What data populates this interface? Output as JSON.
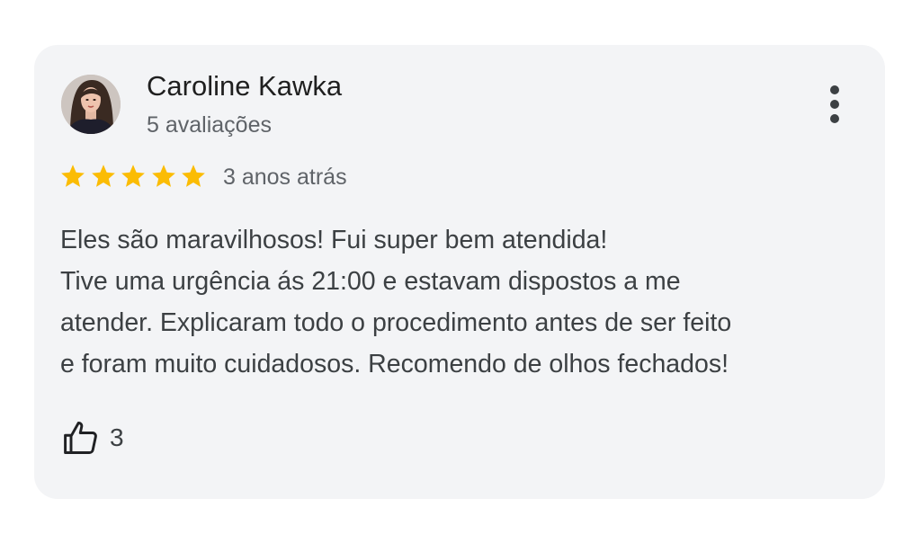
{
  "review": {
    "reviewer_name": "Caroline Kawka",
    "review_count": "5 avaliações",
    "rating": 5,
    "rating_max": 5,
    "date": "3 anos atrás",
    "text_lines": [
      "Eles são maravilhosos! Fui super bem atendida!",
      "Tive uma urgência ás 21:00 e estavam dispostos a me",
      "atender. Explicaram todo o procedimento antes de ser feito",
      "e foram muito cuidadosos. Recomendo de olhos fechados!"
    ],
    "like_count": "3"
  },
  "icons": {
    "more": "more-vert-icon",
    "star": "star-icon",
    "like": "thumbs-up-icon"
  },
  "colors": {
    "card_background": "#f3f4f6",
    "star": "#fbbc04",
    "name_text": "#1f1f1f",
    "secondary_text": "#5f6368",
    "body_text": "#3c4043"
  }
}
